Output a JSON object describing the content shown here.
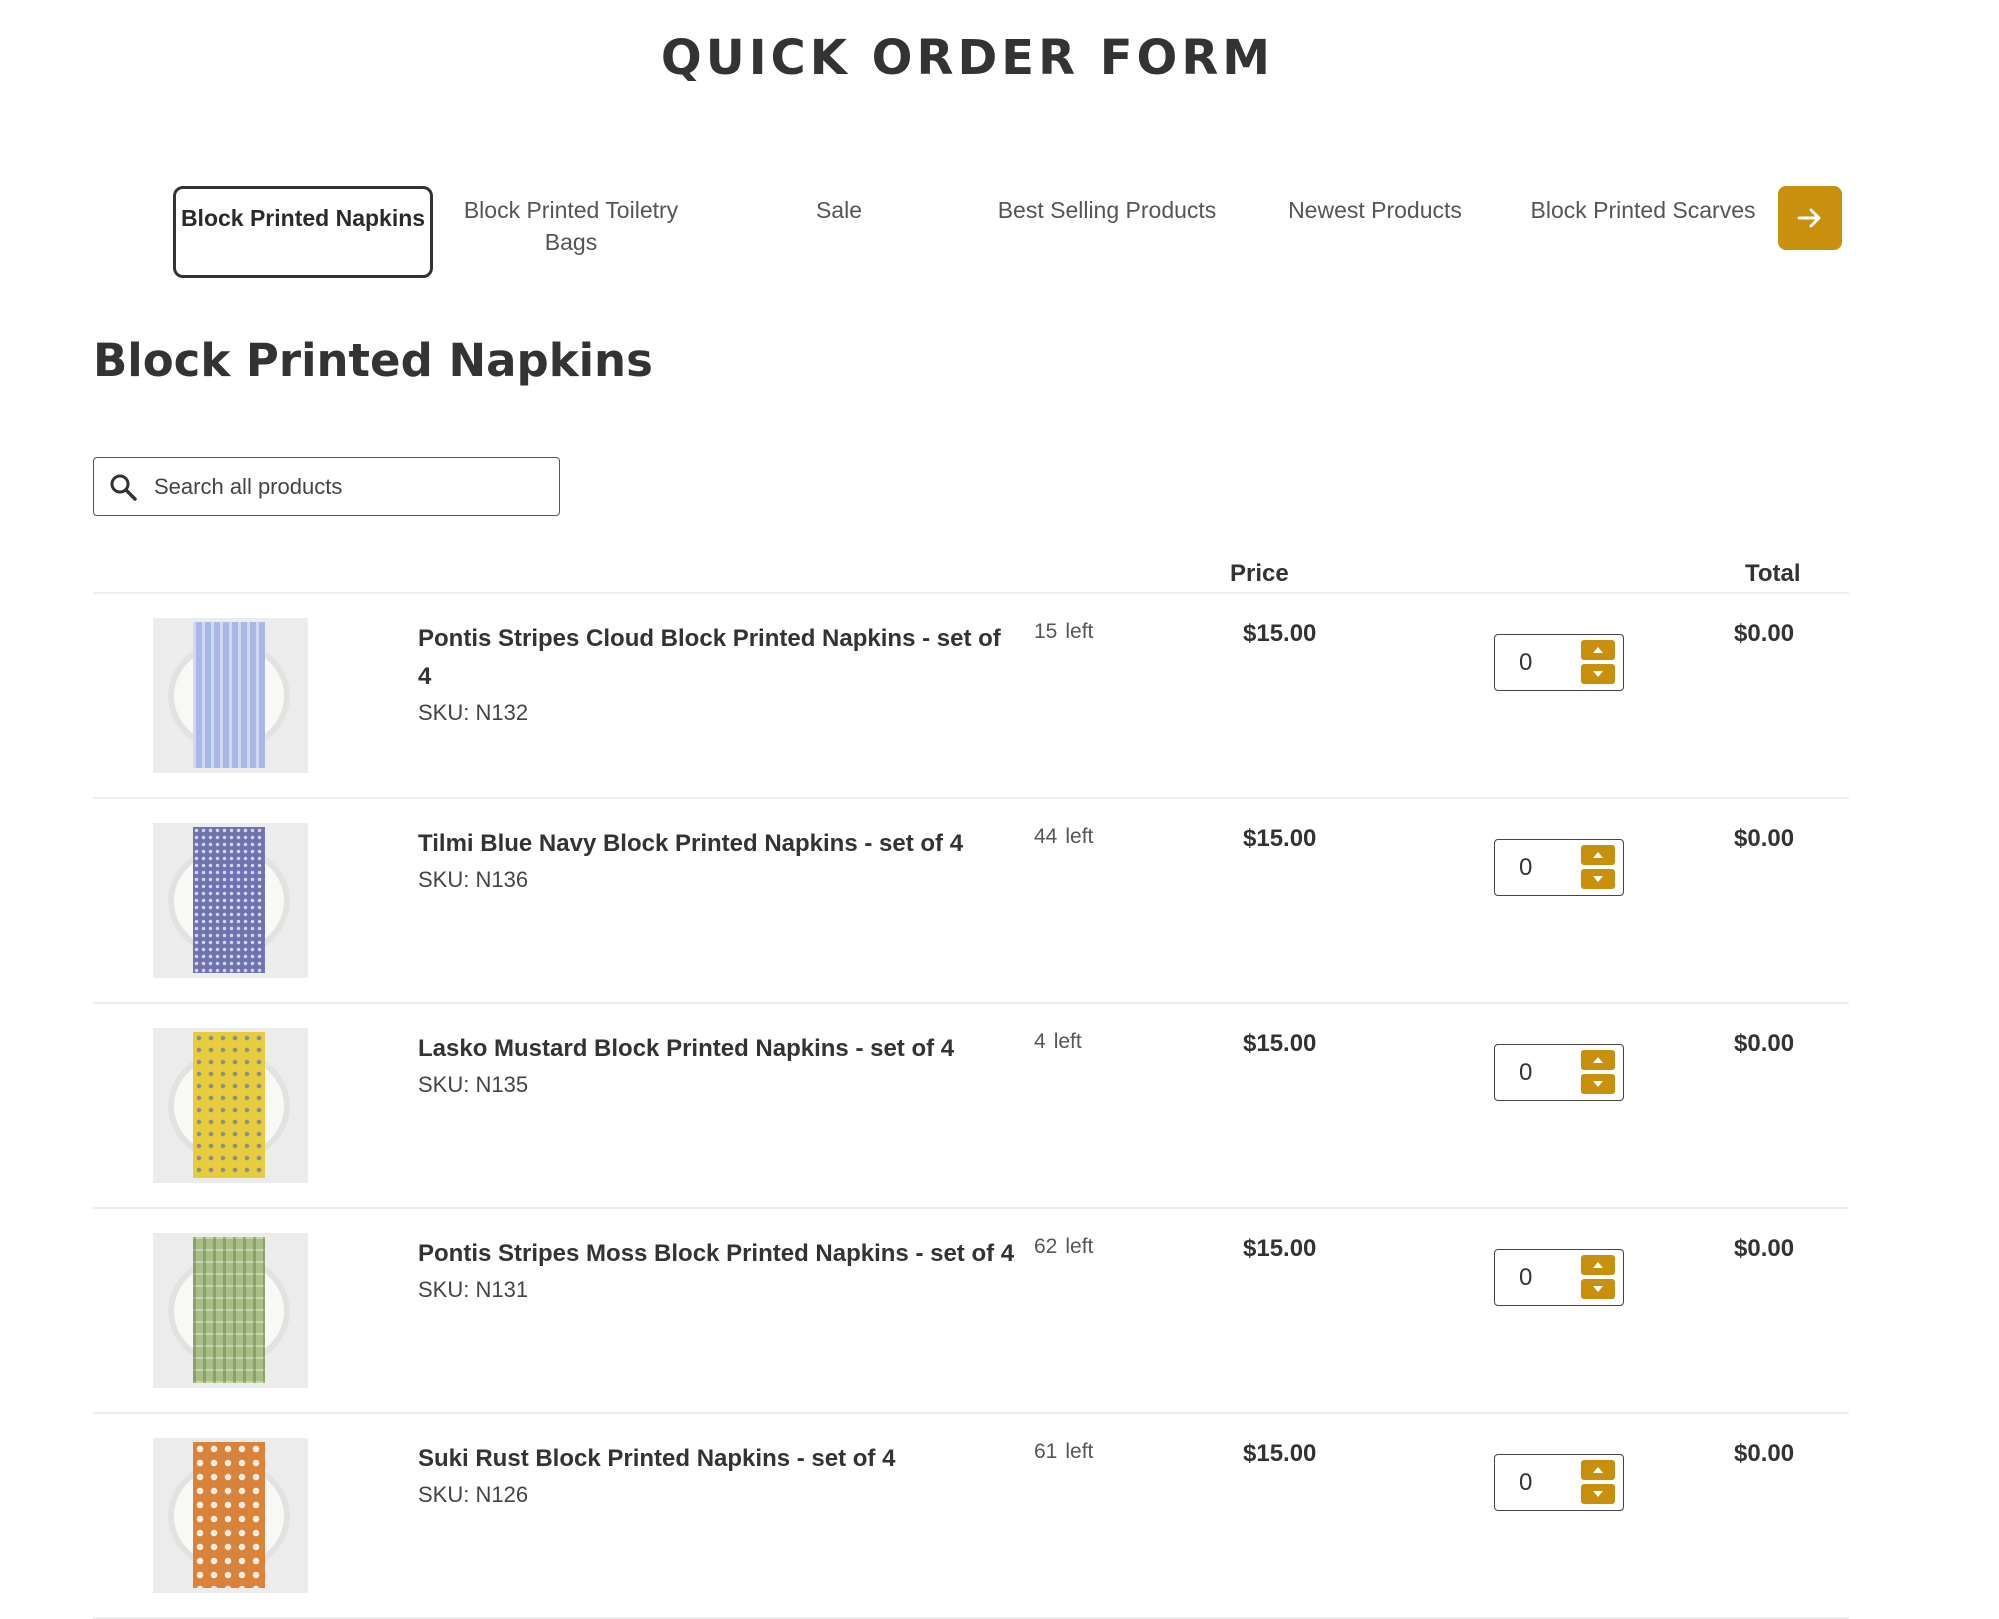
{
  "page": {
    "title": "QUICK ORDER FORM"
  },
  "tabs": [
    {
      "label": "Block Printed Napkins",
      "active": true
    },
    {
      "label": "Block Printed Toiletry Bags",
      "active": false
    },
    {
      "label": "Sale",
      "active": false
    },
    {
      "label": "Best Selling Products",
      "active": false
    },
    {
      "label": "Newest Products",
      "active": false
    },
    {
      "label": "Block Printed Scarves",
      "active": false
    }
  ],
  "tabs_next_icon": "arrow-right-icon",
  "section": {
    "title": "Block Printed Napkins"
  },
  "search": {
    "placeholder": "Search all products",
    "value": ""
  },
  "table": {
    "headers": {
      "price": "Price",
      "total": "Total"
    },
    "rows": [
      {
        "name": "Pontis Stripes Cloud Block Printed Napkins - set of 4",
        "sku": "SKU: N132",
        "stock_count": "15",
        "stock_label": "left",
        "price": "$15.00",
        "qty": "0",
        "total": "$0.00",
        "swatch": "#aab8e8"
      },
      {
        "name": "Tilmi Blue Navy Block Printed Napkins - set of 4",
        "sku": "SKU: N136",
        "stock_count": "44",
        "stock_label": "left",
        "price": "$15.00",
        "qty": "0",
        "total": "$0.00",
        "swatch": "#6e72b0"
      },
      {
        "name": "Lasko Mustard Block Printed Napkins - set of 4",
        "sku": "SKU: N135",
        "stock_count": "4",
        "stock_label": "left",
        "price": "$15.00",
        "qty": "0",
        "total": "$0.00",
        "swatch": "#e6cc3e"
      },
      {
        "name": "Pontis Stripes Moss Block Printed Napkins - set of 4",
        "sku": "SKU: N131",
        "stock_count": "62",
        "stock_label": "left",
        "price": "$15.00",
        "qty": "0",
        "total": "$0.00",
        "swatch": "#a9bd86"
      },
      {
        "name": "Suki Rust Block Printed Napkins - set of 4",
        "sku": "SKU: N126",
        "stock_count": "61",
        "stock_label": "left",
        "price": "$15.00",
        "qty": "0",
        "total": "$0.00",
        "swatch": "#d9823a"
      }
    ]
  },
  "colors": {
    "accent": "#c8900c",
    "text": "#333333",
    "divider": "#eeeeee"
  }
}
